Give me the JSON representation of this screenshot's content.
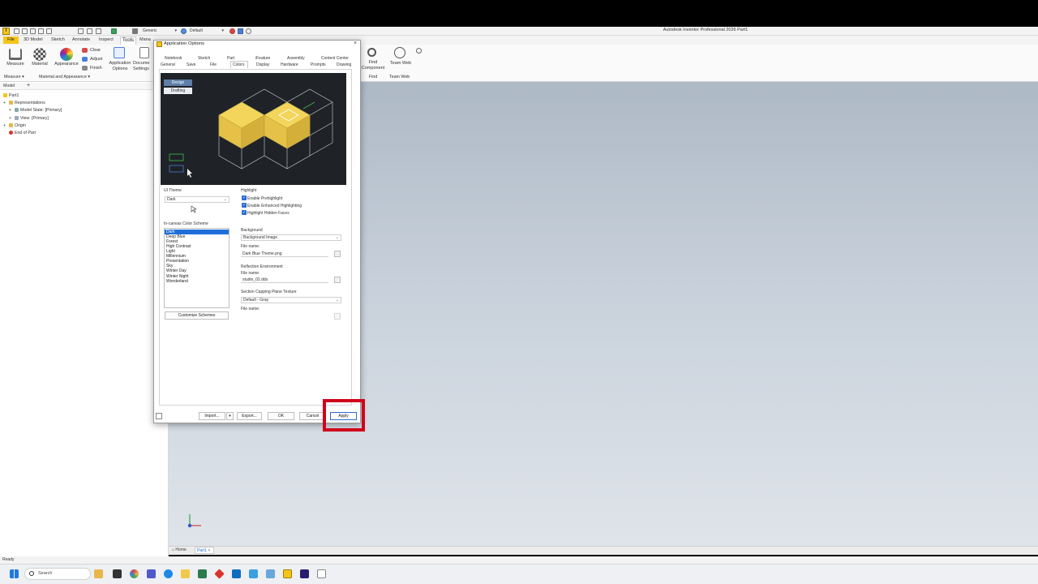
{
  "app": {
    "title": "Autodesk Inventor Professional 2026   Part1",
    "icon_letter": "I",
    "qat_material": "Generic",
    "qat_appearance": "Default"
  },
  "ribbon": {
    "tabs": [
      "File",
      "3D Model",
      "Sketch",
      "Annotate",
      "Inspect",
      "Tools",
      "Mana"
    ],
    "buttons": {
      "measure": "Measure",
      "material": "Material",
      "appearance": "Appearance",
      "clear": "Clear",
      "adjust": "Adjust",
      "finish": "Finish",
      "app_options_1": "Application",
      "app_options_2": "Options",
      "doc_settings_1": "Docume",
      "doc_settings_2": "Settings",
      "find_1": "Find",
      "find_2": "Component",
      "team_web": "Team Web"
    },
    "groups": {
      "measure": "Measure ▾",
      "material": "Material and Appearance ▾",
      "find": "Find",
      "team_web": "Team Web"
    }
  },
  "browser": {
    "tab": "Model",
    "add": "+",
    "root": "Part1",
    "items": [
      "Representations",
      "Model State: [Primary]",
      "View: [Primary]",
      "Origin",
      "End of Part"
    ]
  },
  "doc_tabs": {
    "home": "Home",
    "part1": "Part1"
  },
  "status": {
    "text": "Ready"
  },
  "taskbar": {
    "search": "Search"
  },
  "dialog": {
    "title": "Application Options",
    "close": "×",
    "tabs_row1": [
      "Notebook",
      "Sketch",
      "Part",
      "iFeature",
      "Assembly",
      "Content Center"
    ],
    "tabs_row2": [
      "General",
      "Save",
      "File",
      "Colors",
      "Display",
      "Hardware",
      "Prompts",
      "Drawing"
    ],
    "preview": {
      "design": "Design",
      "drafting": "Drafting"
    },
    "ui_theme": {
      "label": "UI Theme",
      "value": "Dark"
    },
    "highlight": {
      "label": "Highlight",
      "options": [
        "Enable Prehighlight",
        "Enable Enhanced Highlighting",
        "Highlight Hidden Faces"
      ]
    },
    "color_scheme": {
      "label": "In-canvas Color Scheme",
      "items": [
        "Dark",
        "Deep Blue",
        "Forest",
        "High Contrast",
        "Light",
        "Millennium",
        "Presentation",
        "Sky",
        "Winter Day",
        "Winter Night",
        "Wonderland"
      ],
      "selected": "Dark",
      "customize": "Customize Schemes"
    },
    "background": {
      "label": "Background",
      "value": "Background Image",
      "file_label": "File name:",
      "file": "Dark Blue Theme.png"
    },
    "reflection": {
      "label": "Reflection Environment",
      "file_label": "File name:",
      "file": "studio_02.dds"
    },
    "capping": {
      "label": "Section Capping Plane Texture",
      "value": "Default - Gray",
      "file_label": "File name:"
    },
    "buttons": {
      "import": "Import...",
      "export": "Export...",
      "ok": "OK",
      "cancel": "Cancel",
      "apply": "Apply"
    }
  },
  "colors": {
    "accent_yellow": "#f5c518",
    "highlight_red": "#d0021b",
    "selection_blue": "#1e6fd9"
  }
}
